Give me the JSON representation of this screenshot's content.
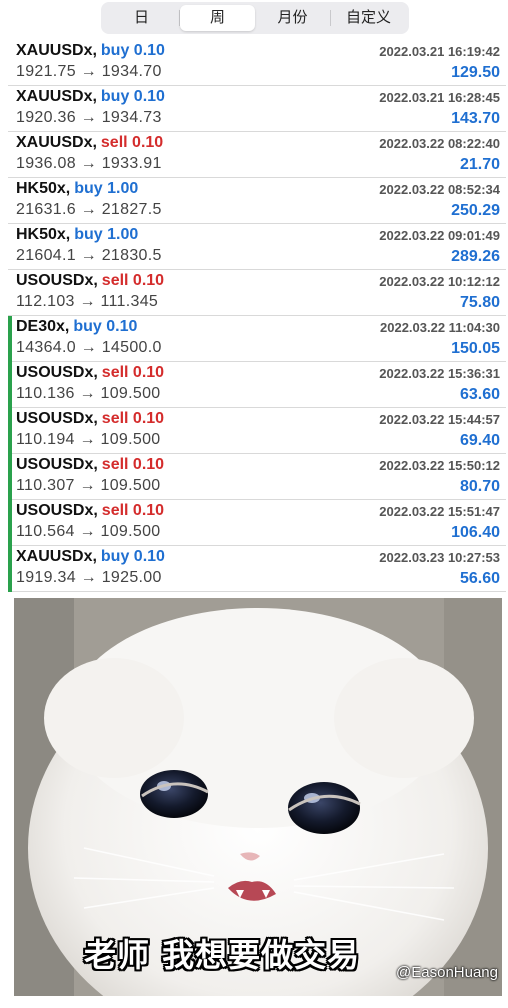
{
  "tabs": [
    {
      "label": "日",
      "active": false
    },
    {
      "label": "周",
      "active": true
    },
    {
      "label": "月份",
      "active": false
    },
    {
      "label": "自定义",
      "active": false
    }
  ],
  "trades": [
    {
      "symbol": "XAUUSDx,",
      "side": "buy 0.10",
      "side_type": "buy",
      "date": "2022.03.21 16:19:42",
      "prices": "1921.75 → 1934.70",
      "profit": "129.50",
      "bar": false
    },
    {
      "symbol": "XAUUSDx,",
      "side": "buy 0.10",
      "side_type": "buy",
      "date": "2022.03.21 16:28:45",
      "prices": "1920.36 → 1934.73",
      "profit": "143.70",
      "bar": false
    },
    {
      "symbol": "XAUUSDx,",
      "side": "sell 0.10",
      "side_type": "sell",
      "date": "2022.03.22 08:22:40",
      "prices": "1936.08 → 1933.91",
      "profit": "21.70",
      "bar": false
    },
    {
      "symbol": "HK50x,",
      "side": "buy 1.00",
      "side_type": "buy",
      "date": "2022.03.22 08:52:34",
      "prices": "21631.6 → 21827.5",
      "profit": "250.29",
      "bar": false
    },
    {
      "symbol": "HK50x,",
      "side": "buy 1.00",
      "side_type": "buy",
      "date": "2022.03.22 09:01:49",
      "prices": "21604.1 → 21830.5",
      "profit": "289.26",
      "bar": false
    },
    {
      "symbol": "USOUSDx,",
      "side": "sell 0.10",
      "side_type": "sell",
      "date": "2022.03.22 10:12:12",
      "prices": "112.103 → 111.345",
      "profit": "75.80",
      "bar": false
    },
    {
      "symbol": "DE30x,",
      "side": "buy 0.10",
      "side_type": "buy",
      "date": "2022.03.22 11:04:30",
      "prices": "14364.0 → 14500.0",
      "profit": "150.05",
      "bar": true
    },
    {
      "symbol": "USOUSDx,",
      "side": "sell 0.10",
      "side_type": "sell",
      "date": "2022.03.22 15:36:31",
      "prices": "110.136 → 109.500",
      "profit": "63.60",
      "bar": true
    },
    {
      "symbol": "USOUSDx,",
      "side": "sell 0.10",
      "side_type": "sell",
      "date": "2022.03.22 15:44:57",
      "prices": "110.194 → 109.500",
      "profit": "69.40",
      "bar": true
    },
    {
      "symbol": "USOUSDx,",
      "side": "sell 0.10",
      "side_type": "sell",
      "date": "2022.03.22 15:50:12",
      "prices": "110.307 → 109.500",
      "profit": "80.70",
      "bar": true
    },
    {
      "symbol": "USOUSDx,",
      "side": "sell 0.10",
      "side_type": "sell",
      "date": "2022.03.22 15:51:47",
      "prices": "110.564 → 109.500",
      "profit": "106.40",
      "bar": true
    },
    {
      "symbol": "XAUUSDx,",
      "side": "buy 0.10",
      "side_type": "buy",
      "date": "2022.03.23 10:27:53",
      "prices": "1919.34 → 1925.00",
      "profit": "56.60",
      "bar": true
    }
  ],
  "meme": {
    "caption": "老师 我想要做交易",
    "watermark": "@EasonHuang",
    "image": "crying-white-cat"
  },
  "colors": {
    "buy": "#1f6fd1",
    "sell": "#d42c2c",
    "profit": "#1f6fd1",
    "bar": "#2aa14c"
  }
}
